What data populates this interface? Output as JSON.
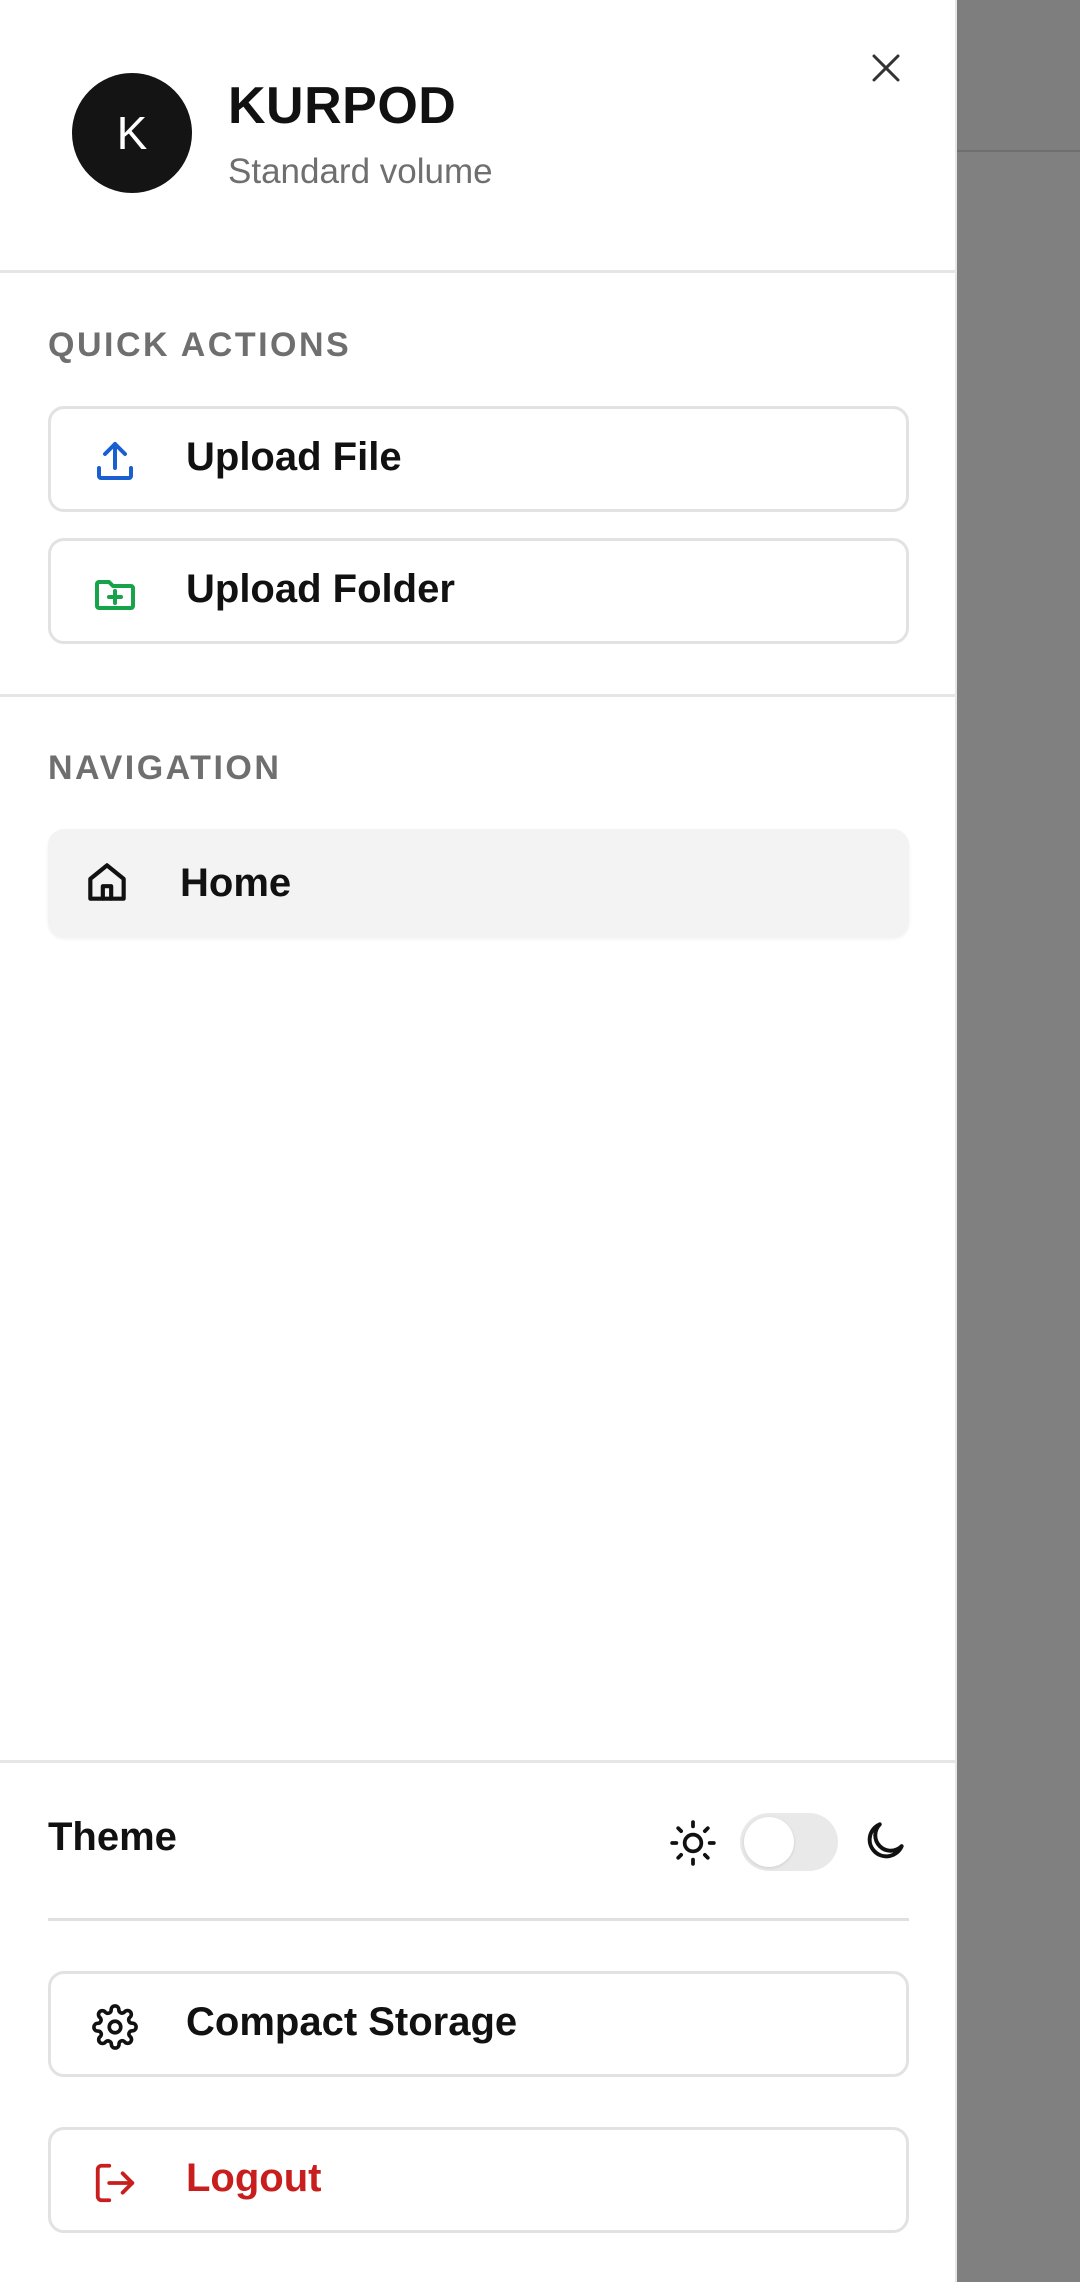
{
  "drawer": {
    "avatar_letter": "K",
    "volume_name": "KURPOD",
    "volume_type": "Standard volume"
  },
  "quick_actions": {
    "section_label": "QUICK ACTIONS",
    "upload_file_label": "Upload File",
    "upload_folder_label": "Upload Folder"
  },
  "navigation": {
    "section_label": "NAVIGATION",
    "items": [
      {
        "label": "Home",
        "icon": "home-icon"
      }
    ]
  },
  "footer": {
    "theme_label": "Theme",
    "theme_dark_enabled": false,
    "compact_storage_label": "Compact Storage",
    "logout_label": "Logout"
  },
  "colors": {
    "upload_icon": "#1a5fd0",
    "folder_icon": "#16a34a",
    "logout": "#c81e1e",
    "avatar_bg": "#141414"
  }
}
